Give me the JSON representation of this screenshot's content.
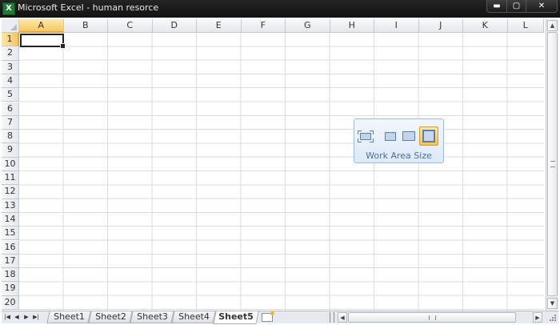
{
  "window": {
    "title": "Microsoft Excel - human resorce",
    "app_icon_letter": "X",
    "min_glyph": "▬",
    "max_glyph": "▢",
    "close_glyph": "✕"
  },
  "grid": {
    "columns": [
      "A",
      "B",
      "C",
      "D",
      "E",
      "F",
      "G",
      "H",
      "I",
      "J",
      "K",
      "L"
    ],
    "rows": [
      "1",
      "2",
      "3",
      "4",
      "5",
      "6",
      "7",
      "8",
      "9",
      "10",
      "11",
      "12",
      "13",
      "14",
      "15",
      "16",
      "17",
      "18",
      "19",
      "20"
    ],
    "active_cell": "A1"
  },
  "sheets": {
    "tabs": [
      "Sheet1",
      "Sheet2",
      "Sheet3",
      "Sheet4",
      "Sheet5"
    ],
    "active": "Sheet5",
    "nav_glyphs": [
      "|◀",
      "◀",
      "▶",
      "▶|"
    ]
  },
  "widget": {
    "label": "Work Area Size",
    "options": [
      "full-screen",
      "small",
      "medium",
      "large"
    ],
    "selected": "large"
  },
  "icons": {
    "app": "excel-icon",
    "new_sheet": "insert-sheet-icon",
    "scroll_up": "▲",
    "scroll_down": "▼",
    "scroll_left": "◀",
    "scroll_right": "▶"
  }
}
